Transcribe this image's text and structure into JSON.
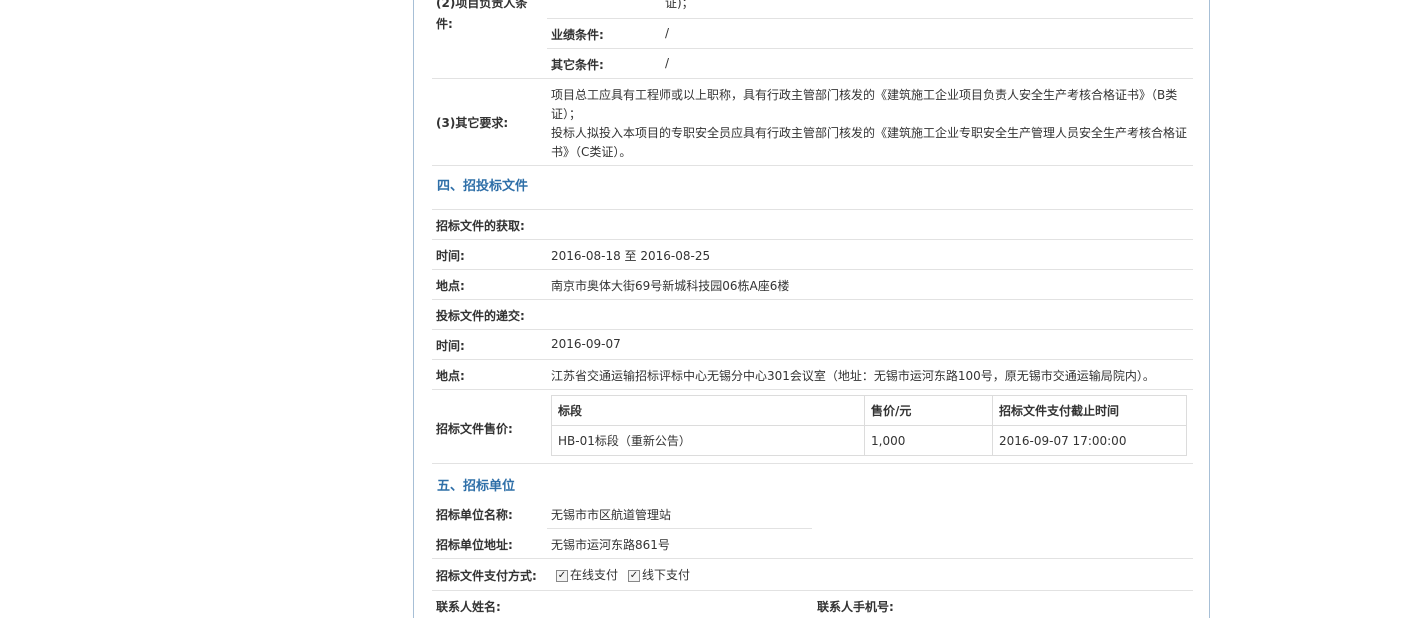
{
  "req2": {
    "label_line1": "(2)项目负责人条",
    "label_line2": "件:",
    "top_fragment": "证)；",
    "perf_label": "业绩条件:",
    "perf_value": "/",
    "other_label": "其它条件:",
    "other_value": "/"
  },
  "req3": {
    "label": "(3)其它要求:",
    "line1": "项目总工应具有工程师或以上职称，具有行政主管部门核发的《建筑施工企业项目负责人安全生产考核合格证书》（B类",
    "line2": "证）；",
    "line3": "投标人拟投入本项目的专职安全员应具有行政主管部门核发的《建筑施工企业专职安全生产管理人员安全生产考核合格证",
    "line4": "书》（C类证）。"
  },
  "section4": {
    "title": "四、招投标文件",
    "obtain_label": "招标文件的获取:",
    "time_label": "时间:",
    "time_value": "2016-08-18 至 2016-08-25",
    "place_label": "地点:",
    "place_value": "南京市奥体大街69号新城科技园06栋A座6楼",
    "submit_label": "投标文件的递交:",
    "submit_time_label": "时间:",
    "submit_time_value": "2016-09-07",
    "submit_place_label": "地点:",
    "submit_place_value": "江苏省交通运输招标评标中心无锡分中心301会议室（地址：无锡市运河东路100号，原无锡市交通运输局院内）。",
    "price_label": "招标文件售价:",
    "price_table": {
      "headers": [
        "标段",
        "售价/元",
        "招标文件支付截止时间"
      ],
      "rows": [
        [
          "HB-01标段（重新公告）",
          "1,000",
          "2016-09-07 17:00:00"
        ]
      ]
    }
  },
  "section5": {
    "title": "五、招标单位",
    "name_label": "招标单位名称:",
    "name_value": "无锡市市区航道管理站",
    "addr_label": "招标单位地址:",
    "addr_value": "无锡市运河东路861号",
    "pay_label": "招标文件支付方式:",
    "pay_online": "在线支付",
    "pay_offline": "线下支付",
    "contact_label": "联系人姓名:",
    "mobile_label": "联系人手机号:"
  },
  "colors": {
    "border": "#a7bfd6",
    "section_title": "#2f6fa8",
    "divider": "#e2e2e2"
  }
}
